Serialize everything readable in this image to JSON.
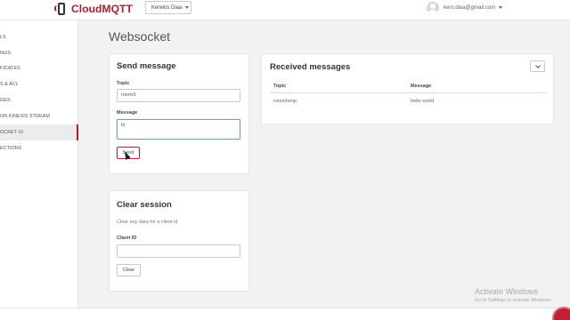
{
  "header": {
    "logo_text": "CloudMQTT",
    "instance_name": "Kerelos Diaa",
    "user_email": "kero.diaa@gmail.com"
  },
  "sidebar": {
    "items": [
      {
        "label": "LS"
      },
      {
        "label": "NGS"
      },
      {
        "label": "FICATES"
      },
      {
        "label": "S & ACL"
      },
      {
        "label": "GES"
      },
      {
        "label": "ON KINESIS STREAM"
      },
      {
        "label": "OCKET UI",
        "active": true
      },
      {
        "label": "ECTIONS"
      }
    ]
  },
  "page": {
    "title": "Websocket"
  },
  "send_message": {
    "title": "Send message",
    "topic_label": "Topic",
    "topic_value": "room/1",
    "message_label": "Message",
    "message_value": "hi",
    "send_label": "Send"
  },
  "clear_session": {
    "title": "Clear session",
    "description": "Clear any data for a client id",
    "client_id_label": "Client ID",
    "client_id_value": "",
    "clear_label": "Clear"
  },
  "received": {
    "title": "Received messages",
    "columns": [
      "Topic",
      "Message"
    ],
    "rows": [
      {
        "topic": "room/lamp",
        "message": "hello world"
      }
    ]
  },
  "watermark": {
    "line1": "Activate Windows",
    "line2": "Go to Settings to activate Windows."
  },
  "colors": {
    "brand": "#b11c2c",
    "background": "#f2f2f5"
  }
}
